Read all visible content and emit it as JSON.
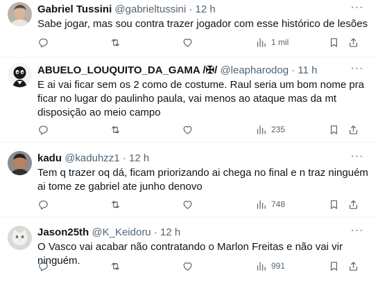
{
  "tweets": [
    {
      "name": "Gabriel Tussini",
      "handle": "@gabrieltussini",
      "time": "12 h",
      "text": "Sabe jogar, mas sou contra trazer jogador com esse histórico de lesões",
      "views": "1 mil",
      "avatar_icon": "person-photo-avatar"
    },
    {
      "name": "ABUELO_LOUQUITO_DA_GAMA /✠/",
      "handle": "@leapharodog",
      "time": "11 h",
      "text": "E ai vai ficar sem os 2 como de costume. Raul seria um bom nome pra ficar no lugar do paulinho paula, vai menos ao ataque mas da mt disposição ao meio campo",
      "views": "235",
      "avatar_icon": "cartoon-avatar"
    },
    {
      "name": "kadu",
      "handle": "@kaduhzz1",
      "time": "12 h",
      "text": "Tem q trazer oq dá, ficam priorizando ai chega no final e n traz ninguém ai tome ze gabriel ate junho denovo",
      "views": "748",
      "avatar_icon": "person-photo-avatar"
    },
    {
      "name": "Jason25th",
      "handle": "@K_Keidoru",
      "time": "12 h",
      "text": "O Vasco vai acabar não contratando o Marlon Freitas e não vai vir ninguém.",
      "views": "991",
      "avatar_icon": "cat-photo-avatar"
    }
  ],
  "separator": "·",
  "more_glyph": "···",
  "colors": {
    "secondary": "#536471",
    "primary": "#0f1419",
    "divider": "#eff3f4"
  }
}
